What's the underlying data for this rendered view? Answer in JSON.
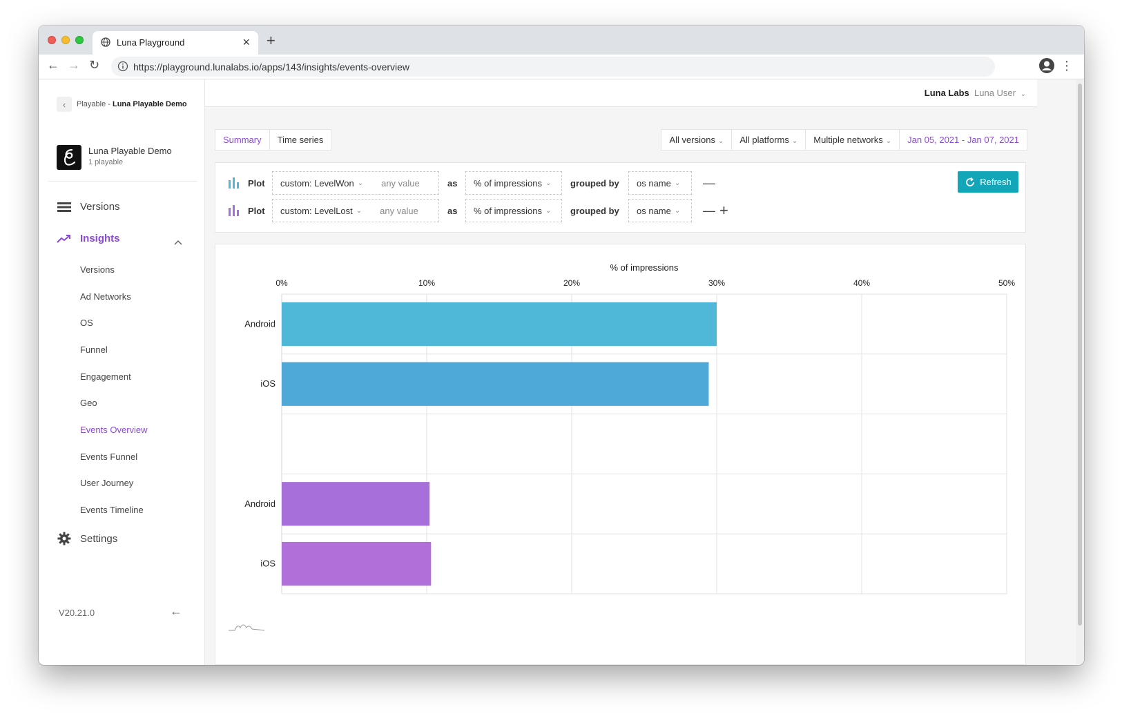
{
  "browser": {
    "tab_title": "Luna Playground",
    "url": "https://playground.lunalabs.io/apps/143/insights/events-overview"
  },
  "sidebar": {
    "back_prefix": "Playable - ",
    "back_name": "Luna Playable Demo",
    "app_name": "Luna Playable Demo",
    "app_count": "1 playable",
    "versions_label": "Versions",
    "insights_label": "Insights",
    "sub_items": [
      {
        "label": "Versions",
        "active": false
      },
      {
        "label": "Ad Networks",
        "active": false
      },
      {
        "label": "OS",
        "active": false
      },
      {
        "label": "Funnel",
        "active": false
      },
      {
        "label": "Engagement",
        "active": false
      },
      {
        "label": "Geo",
        "active": false
      },
      {
        "label": "Events Overview",
        "active": true
      },
      {
        "label": "Events Funnel",
        "active": false
      },
      {
        "label": "User Journey",
        "active": false
      },
      {
        "label": "Events Timeline",
        "active": false
      }
    ],
    "settings_label": "Settings",
    "version": "V20.21.0"
  },
  "header": {
    "org": "Luna Labs",
    "user": "Luna User"
  },
  "view_tabs": [
    "Summary",
    "Time series"
  ],
  "active_view_tab": "Summary",
  "filters": {
    "versions": "All versions",
    "platforms": "All platforms",
    "networks": "Multiple networks",
    "date_range": "Jan 05, 2021 - Jan 07, 2021"
  },
  "query_rows": [
    {
      "plot_label": "Plot",
      "event": "custom: LevelWon",
      "value": "any value",
      "as_label": "as",
      "metric": "% of impressions",
      "group_label": "grouped by",
      "group": "os name",
      "color": "#4fb8d8"
    },
    {
      "plot_label": "Plot",
      "event": "custom: LevelLost",
      "value": "any value",
      "as_label": "as",
      "metric": "% of impressions",
      "group_label": "grouped by",
      "group": "os name",
      "color": "#a66fd9"
    }
  ],
  "refresh_label": "Refresh",
  "chart_data": {
    "type": "bar",
    "orientation": "horizontal",
    "title": "% of impressions",
    "xlim": [
      0,
      50
    ],
    "x_ticks": [
      "0%",
      "10%",
      "20%",
      "30%",
      "40%",
      "50%"
    ],
    "categories": [
      "Android",
      "iOS",
      "",
      "Android",
      "iOS"
    ],
    "values": [
      30.0,
      29.45,
      null,
      10.2,
      10.3
    ],
    "bar_colors": [
      "#4fb8d8",
      "#4ea9d8",
      null,
      "#a66fd9",
      "#b16fd9"
    ],
    "grid": true
  }
}
